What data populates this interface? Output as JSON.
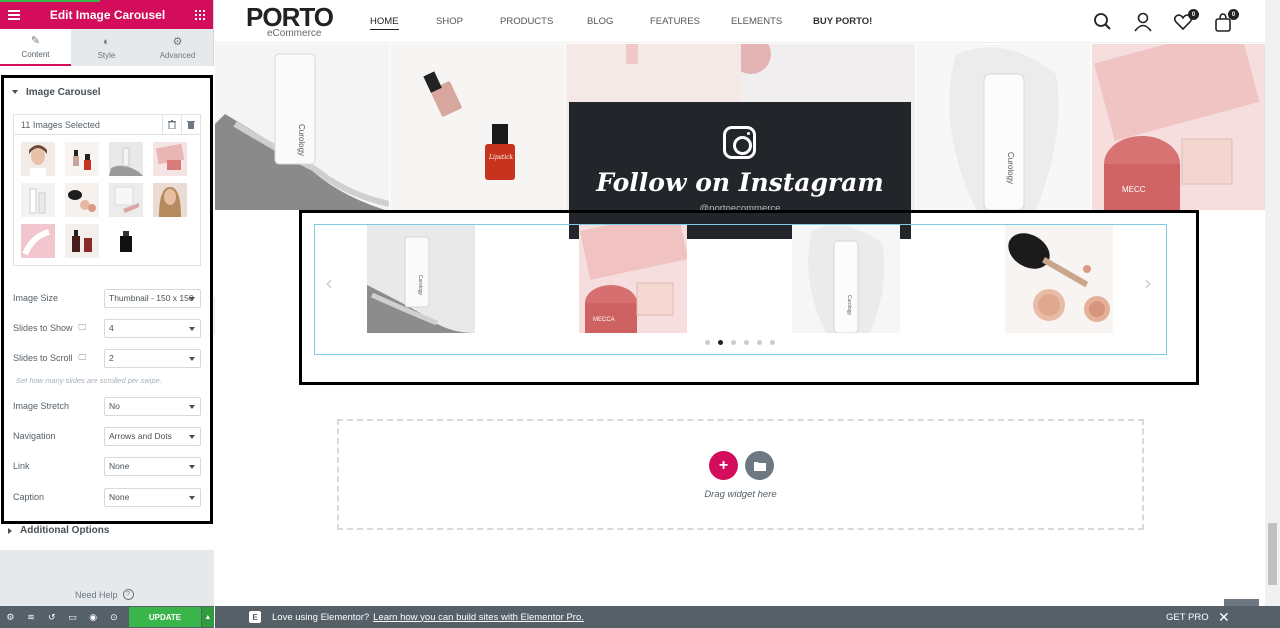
{
  "panel": {
    "header_title": "Edit Image Carousel",
    "tabs": [
      {
        "label": "Content",
        "icon": "pencil-icon"
      },
      {
        "label": "Style",
        "icon": "contrast-icon"
      },
      {
        "label": "Advanced",
        "icon": "gear-icon"
      }
    ],
    "section_title": "Image Carousel",
    "gallery": {
      "count_label": "11 Images Selected"
    },
    "controls": {
      "image_size": {
        "label": "Image Size",
        "value": "Thumbnail - 150 x 150"
      },
      "slides_to_show": {
        "label": "Slides to Show",
        "value": "4"
      },
      "slides_to_scroll": {
        "label": "Slides to Scroll",
        "value": "2"
      },
      "scroll_hint": "Set how many slides are scrolled per swipe.",
      "image_stretch": {
        "label": "Image Stretch",
        "value": "No"
      },
      "navigation": {
        "label": "Navigation",
        "value": "Arrows and Dots"
      },
      "link": {
        "label": "Link",
        "value": "None"
      },
      "caption": {
        "label": "Caption",
        "value": "None"
      }
    },
    "additional_options": "Additional Options",
    "need_help": "Need Help",
    "update_label": "UPDATE"
  },
  "site": {
    "logo_main": "PORTO",
    "logo_sub": "eCommerce",
    "nav": [
      "HOME",
      "SHOP",
      "PRODUCTS",
      "BLOG",
      "FEATURES",
      "ELEMENTS",
      "BUY PORTO!"
    ],
    "wishlist_count": "0",
    "cart_count": "0",
    "follow_title": "Follow on Instagram",
    "follow_handle": "@portoecommerce",
    "carousel_dots": 6,
    "carousel_active_dot": 1,
    "drag_text": "Drag widget here"
  },
  "promo": {
    "text": "Love using Elementor?",
    "link_text": "Learn how you can build sites with Elementor Pro.",
    "get_pro": "GET PRO"
  },
  "colors": {
    "elementor_pink": "#d30c5c",
    "update_green": "#39b54a",
    "instagram_box": "#222529"
  }
}
